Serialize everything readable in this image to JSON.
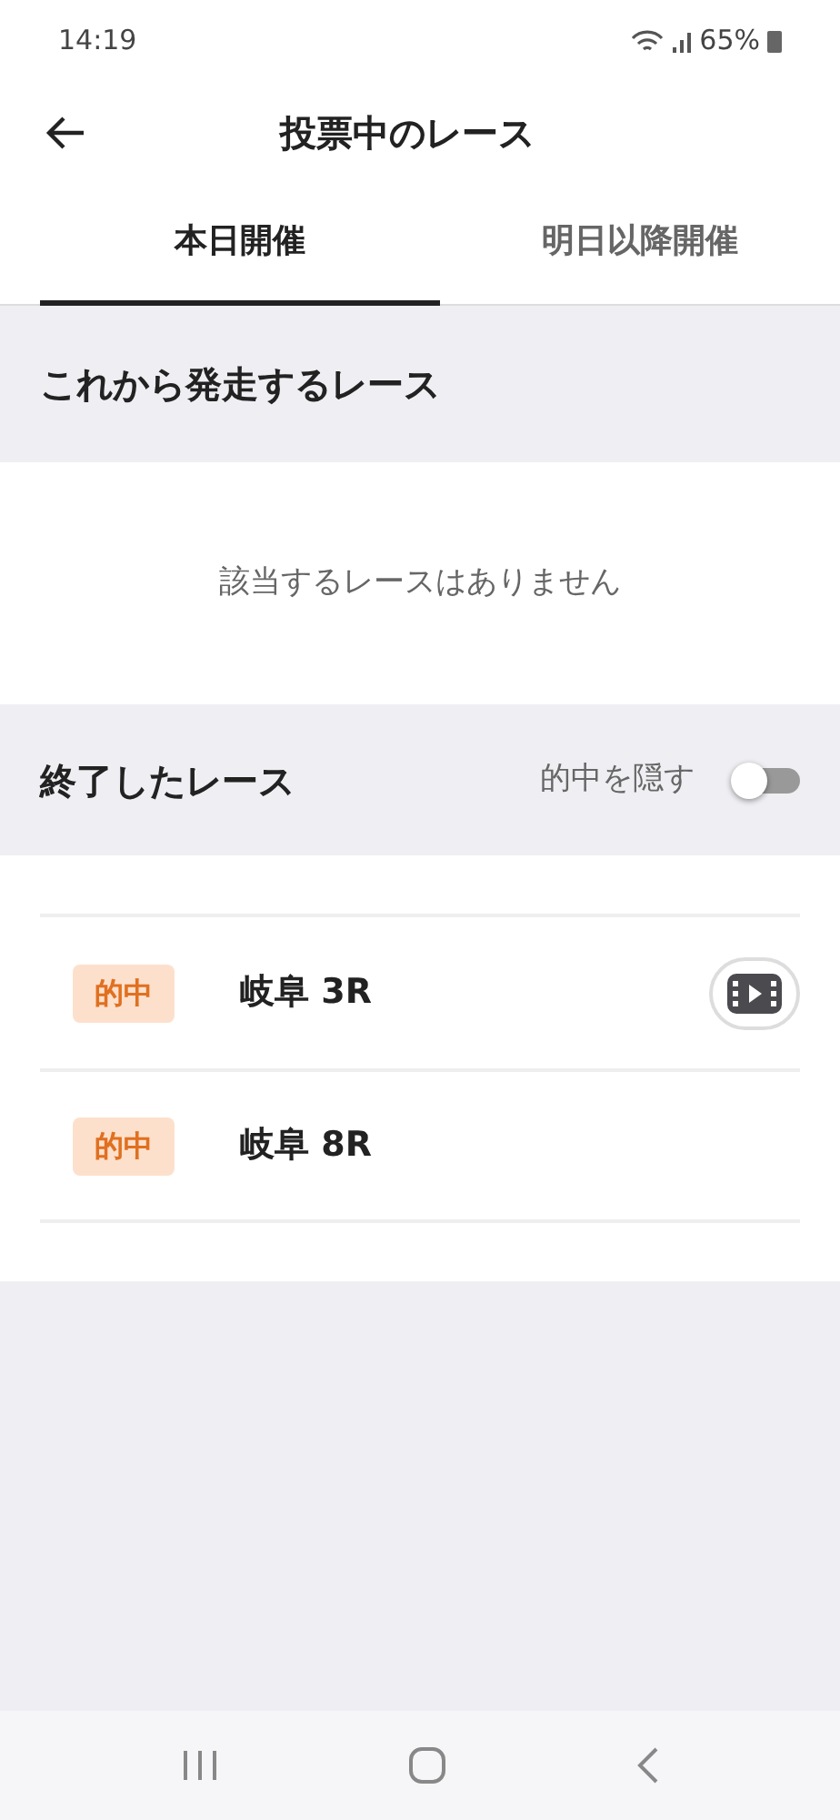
{
  "status_bar": {
    "time": "14:19",
    "battery": "65%"
  },
  "header": {
    "title": "投票中のレース"
  },
  "tabs": [
    {
      "label": "本日開催",
      "selected": true
    },
    {
      "label": "明日以降開催",
      "selected": false
    }
  ],
  "upcoming": {
    "title": "これから発走するレース",
    "empty_message": "該当するレースはありません"
  },
  "finished": {
    "title": "終了したレース",
    "hide_hits_label": "的中を隠す",
    "hide_hits_on": false,
    "races": [
      {
        "badge": "的中",
        "name": "岐阜 3R",
        "has_video": true
      },
      {
        "badge": "的中",
        "name": "岐阜 8R",
        "has_video": false
      }
    ]
  }
}
